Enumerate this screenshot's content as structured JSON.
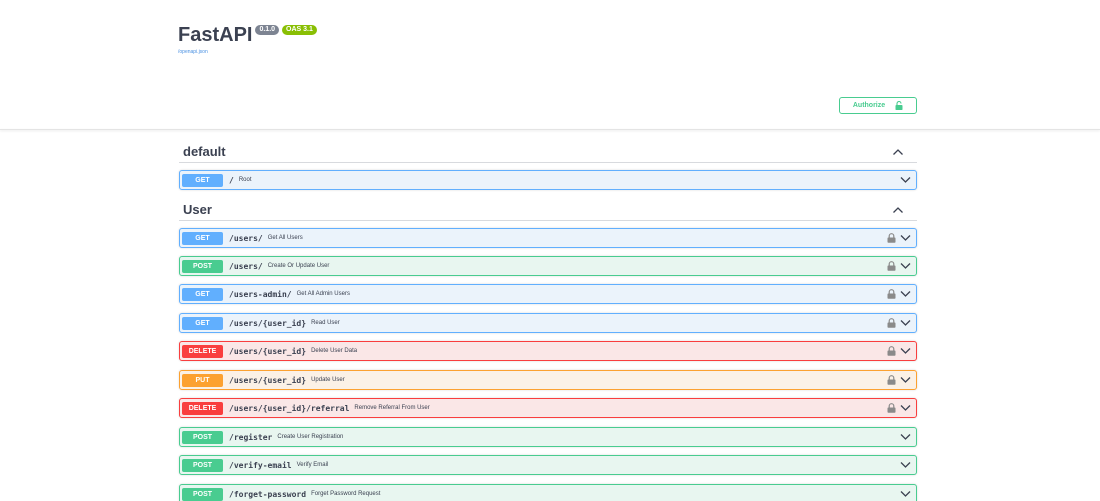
{
  "info": {
    "title": "FastAPI",
    "version": "0.1.0",
    "oas": "OAS 3.1",
    "spec_link": "/openapi.json"
  },
  "authorize": {
    "label": "Authorize",
    "icon": "lock-icon-unlocked"
  },
  "colors": {
    "get": "#61affe",
    "post": "#49cc90",
    "put": "#fca130",
    "delete": "#f93e3e",
    "authorize": "#49cc90"
  },
  "sections": [
    {
      "title": "default",
      "operations": [
        {
          "method": "GET",
          "path": "/",
          "summary": "Root",
          "locked": false
        }
      ]
    },
    {
      "title": "User",
      "operations": [
        {
          "method": "GET",
          "path": "/users/",
          "summary": "Get All Users",
          "locked": true
        },
        {
          "method": "POST",
          "path": "/users/",
          "summary": "Create Or Update User",
          "locked": true
        },
        {
          "method": "GET",
          "path": "/users-admin/",
          "summary": "Get All Admin Users",
          "locked": true
        },
        {
          "method": "GET",
          "path": "/users/{user_id}",
          "summary": "Read User",
          "locked": true
        },
        {
          "method": "DELETE",
          "path": "/users/{user_id}",
          "summary": "Delete User Data",
          "locked": true
        },
        {
          "method": "PUT",
          "path": "/users/{user_id}",
          "summary": "Update User",
          "locked": true
        },
        {
          "method": "DELETE",
          "path": "/users/{user_id}/referral",
          "summary": "Remove Referral From User",
          "locked": true
        },
        {
          "method": "POST",
          "path": "/register",
          "summary": "Create User Registration",
          "locked": false
        },
        {
          "method": "POST",
          "path": "/verify-email",
          "summary": "Verify Email",
          "locked": false
        },
        {
          "method": "POST",
          "path": "/forget-password",
          "summary": "Forget Password Request",
          "locked": false
        }
      ]
    }
  ]
}
